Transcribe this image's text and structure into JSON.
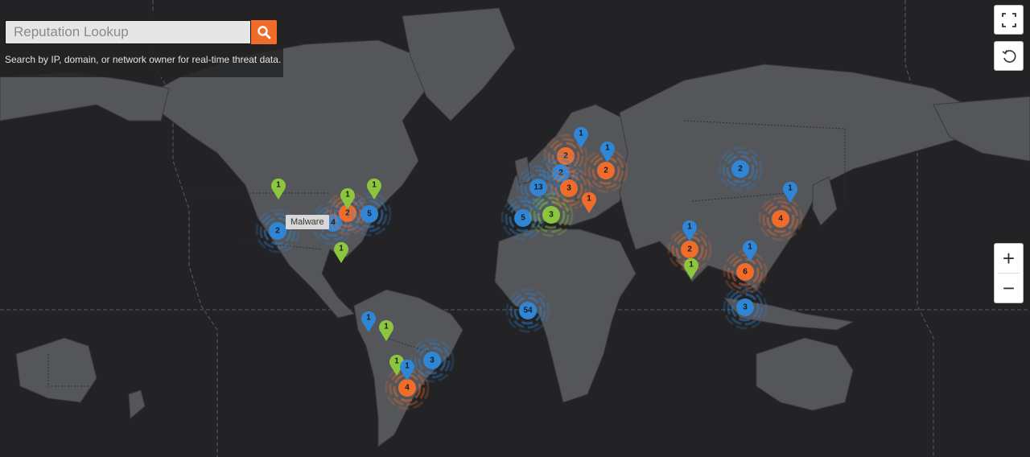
{
  "search": {
    "placeholder": "Reputation Lookup",
    "value": "",
    "button_icon": "search-icon",
    "hint": "Search by IP, domain, or network owner for real-time threat data."
  },
  "controls": {
    "fullscreen_icon": "fullscreen-icon",
    "reset_icon": "reset-view-icon",
    "zoom_in_label": "+",
    "zoom_out_label": "−"
  },
  "tooltip": {
    "text": "Malware"
  },
  "colors": {
    "blue": "#2f86d6",
    "orange": "#ef6c2a",
    "green": "#8cc63f",
    "land": "#54565a",
    "ocean": "#232325",
    "accent": "#ef6c2a"
  },
  "clusters": [
    {
      "region": "us-west",
      "count": "2",
      "color": "blue"
    },
    {
      "region": "us-central",
      "count": "4",
      "color": "blue"
    },
    {
      "region": "us-midwest",
      "count": "2",
      "color": "orange"
    },
    {
      "region": "us-east",
      "count": "5",
      "color": "blue"
    },
    {
      "region": "uk",
      "count": "13",
      "color": "blue"
    },
    {
      "region": "scandinavia-south",
      "count": "2",
      "color": "orange"
    },
    {
      "region": "germany-north",
      "count": "2",
      "color": "blue"
    },
    {
      "region": "central-europe",
      "count": "3",
      "color": "orange"
    },
    {
      "region": "ukraine",
      "count": "2",
      "color": "orange"
    },
    {
      "region": "spain",
      "count": "5",
      "color": "blue"
    },
    {
      "region": "italy",
      "count": "3",
      "color": "green"
    },
    {
      "region": "gulf-of-guinea",
      "count": "54",
      "color": "blue"
    },
    {
      "region": "mongolia",
      "count": "2",
      "color": "blue"
    },
    {
      "region": "east-china",
      "count": "4",
      "color": "orange"
    },
    {
      "region": "india",
      "count": "2",
      "color": "orange"
    },
    {
      "region": "southeast-asia",
      "count": "6",
      "color": "orange"
    },
    {
      "region": "indonesia",
      "count": "3",
      "color": "blue"
    },
    {
      "region": "brazil-south",
      "count": "3",
      "color": "blue"
    },
    {
      "region": "argentina",
      "count": "4",
      "color": "orange"
    }
  ],
  "pins": [
    {
      "region": "canada-west",
      "count": "1",
      "color": "green"
    },
    {
      "region": "great-lakes",
      "count": "1",
      "color": "green"
    },
    {
      "region": "us-northeast",
      "count": "1",
      "color": "green"
    },
    {
      "region": "gulf-of-mexico",
      "count": "1",
      "color": "green"
    },
    {
      "region": "sweden",
      "count": "1",
      "color": "blue"
    },
    {
      "region": "russia-west",
      "count": "1",
      "color": "blue"
    },
    {
      "region": "black-sea",
      "count": "1",
      "color": "orange"
    },
    {
      "region": "north-korea",
      "count": "1",
      "color": "blue"
    },
    {
      "region": "nepal",
      "count": "1",
      "color": "blue"
    },
    {
      "region": "south-india",
      "count": "1",
      "color": "green"
    },
    {
      "region": "indochina",
      "count": "1",
      "color": "blue"
    },
    {
      "region": "peru",
      "count": "1",
      "color": "blue"
    },
    {
      "region": "bolivia",
      "count": "1",
      "color": "green"
    },
    {
      "region": "chile",
      "count": "1",
      "color": "green"
    },
    {
      "region": "uruguay",
      "count": "1",
      "color": "blue"
    }
  ]
}
